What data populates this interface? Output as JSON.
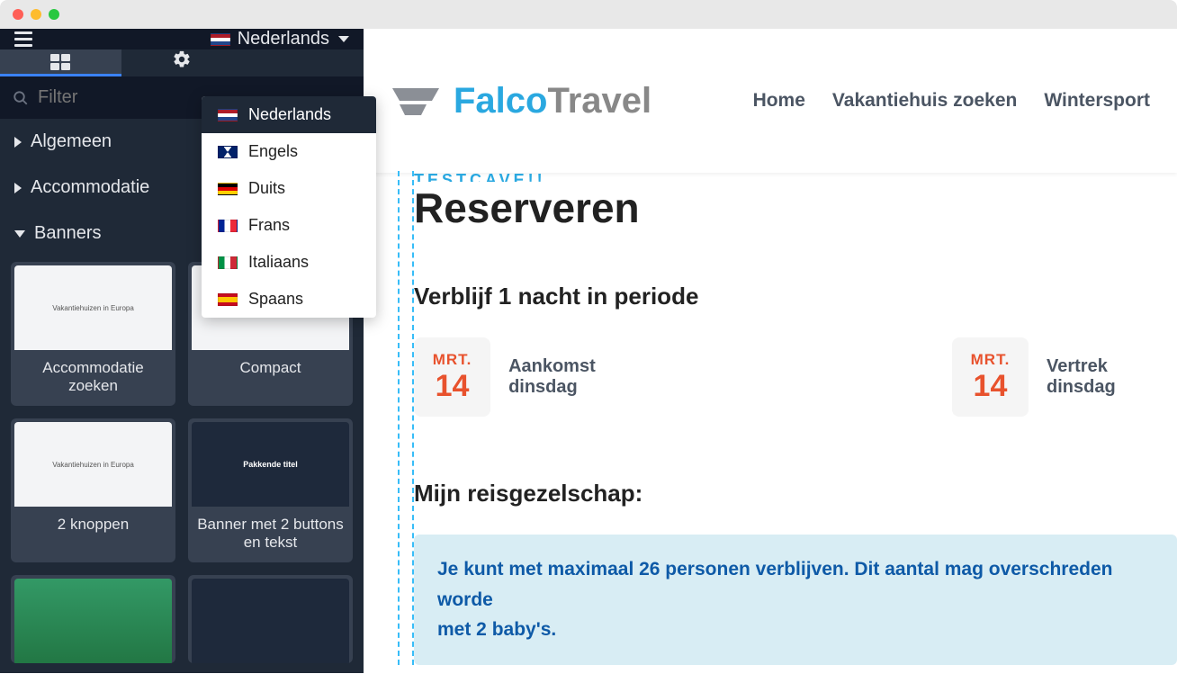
{
  "language": {
    "current": "Nederlands",
    "options": [
      {
        "flag": "nl",
        "label": "Nederlands",
        "active": true
      },
      {
        "flag": "en",
        "label": "Engels"
      },
      {
        "flag": "de",
        "label": "Duits"
      },
      {
        "flag": "fr",
        "label": "Frans"
      },
      {
        "flag": "it",
        "label": "Italiaans"
      },
      {
        "flag": "es",
        "label": "Spaans"
      }
    ]
  },
  "filter": {
    "placeholder": "Filter"
  },
  "sections": {
    "algemeen": "Algemeen",
    "accommodatie": "Accommodatie",
    "banners": "Banners"
  },
  "cards": [
    {
      "label": "Accommodatie zoeken"
    },
    {
      "label": "Compact"
    },
    {
      "label": "2 knoppen"
    },
    {
      "label": "Banner met 2 buttons en tekst"
    }
  ],
  "site": {
    "logo1": "Falco",
    "logo2": "Travel",
    "nav": [
      "Home",
      "Vakantiehuis zoeken",
      "Wintersport"
    ]
  },
  "page": {
    "eyebrow": "TESTCAVE!!",
    "title": "Reserveren",
    "stay_heading": "Verblijf 1 nacht in periode",
    "arrival": {
      "month": "MRT.",
      "day": "14",
      "label": "Aankomst dinsdag"
    },
    "departure": {
      "month": "MRT.",
      "day": "14",
      "label": "Vertrek dinsdag"
    },
    "party_heading": "Mijn reisgezelschap:",
    "notice_pre": "Je kunt met ",
    "notice_strong": "maximaal 26 personen",
    "notice_post1": " verblijven. Dit aantal mag overschreden worde",
    "notice_post2": "met 2 baby's."
  }
}
